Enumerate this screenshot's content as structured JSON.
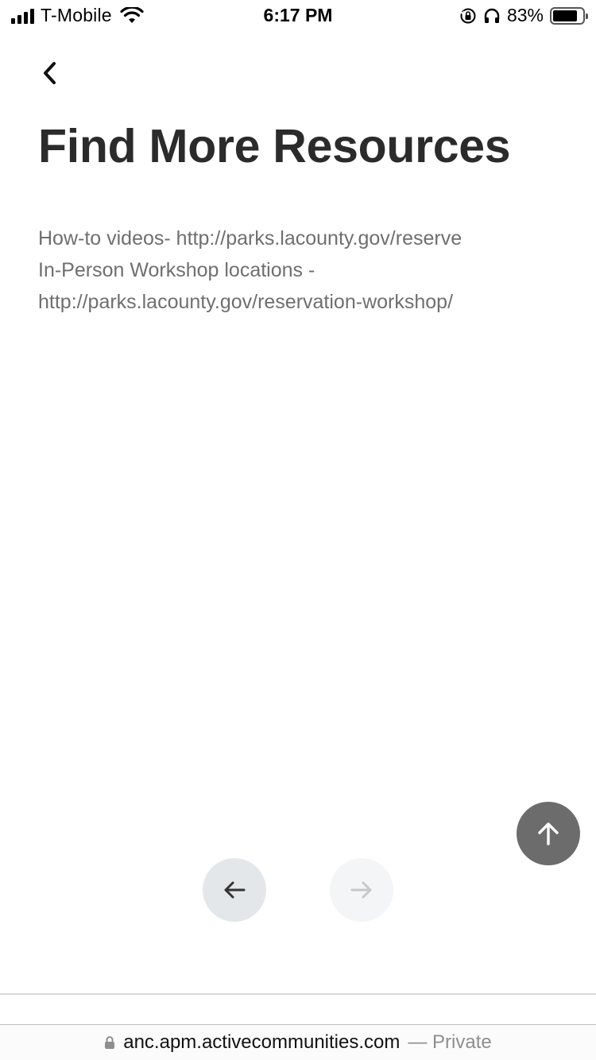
{
  "status_bar": {
    "carrier": "T-Mobile",
    "time": "6:17 PM",
    "battery_percent": "83%",
    "battery_level": 0.83,
    "signal_bars": 4
  },
  "header": {
    "back_icon": "chevron-left-icon"
  },
  "main": {
    "title": "Find More Resources",
    "lines": [
      "How-to videos- http://parks.lacounty.gov/reserve",
      "In-Person Workshop locations -",
      "http://parks.lacounty.gov/reservation-workshop/"
    ]
  },
  "controls": {
    "scroll_top_icon": "arrow-up-icon",
    "prev_icon": "arrow-left-icon",
    "next_icon": "arrow-right-icon"
  },
  "browser": {
    "domain": "anc.apm.activecommunities.com",
    "suffix": "— Private"
  },
  "colors": {
    "title": "#2b2b2b",
    "body_text": "#6f6f6f",
    "fab": "#6c6c6c",
    "prev_button_bg": "#e4e7ea",
    "next_button_bg": "#f4f5f6"
  }
}
